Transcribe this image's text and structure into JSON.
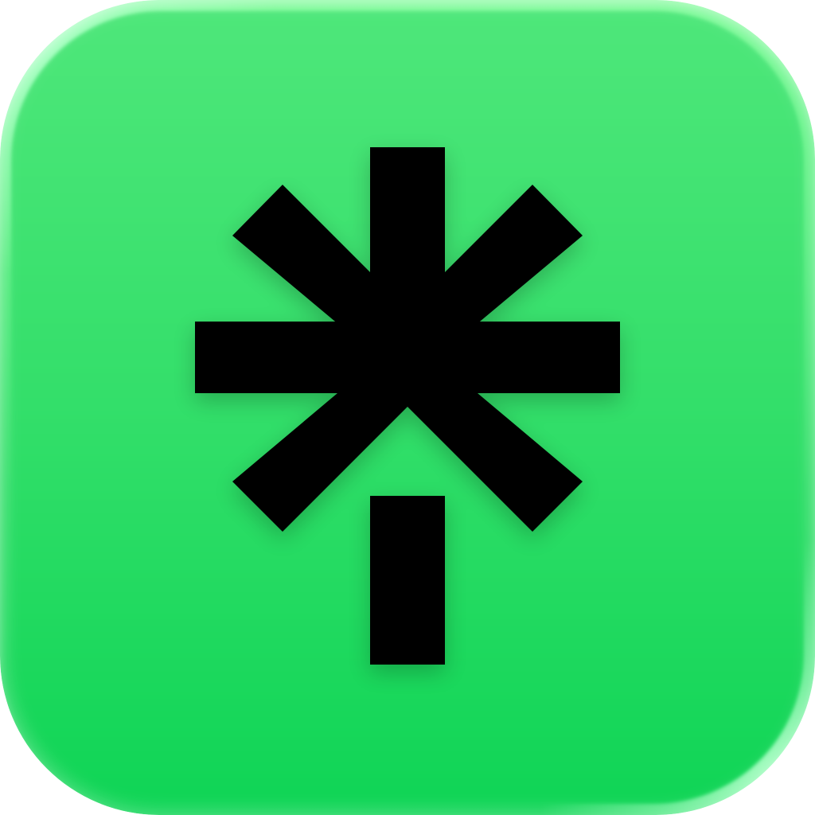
{
  "app_icon": {
    "name": "app-icon",
    "logo_icon": "asterisk-logo-icon",
    "colors": {
      "gradient_top": "#4ee77a",
      "gradient_mid": "#33df6a",
      "gradient_bottom": "#10d556",
      "rim_light": "#7dfb98",
      "rim_corner": "#a6ffc2",
      "mark": "#000000"
    }
  }
}
